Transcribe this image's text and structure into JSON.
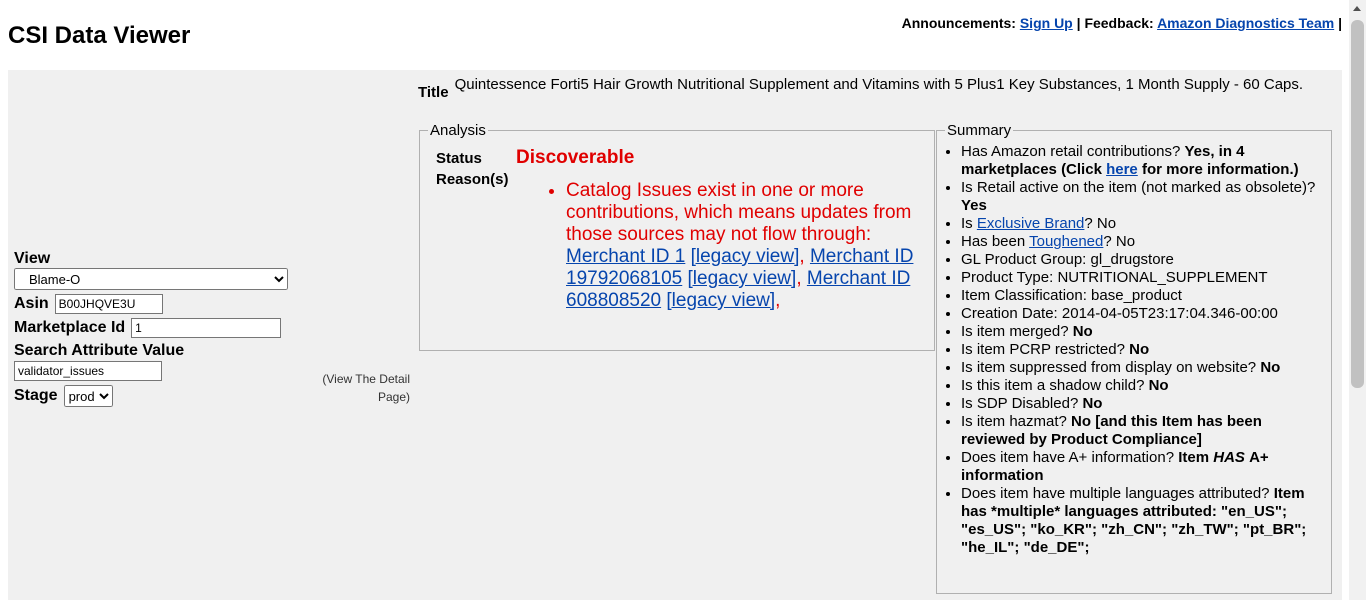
{
  "app_title": "CSI Data Viewer",
  "topbar": {
    "announcements_label": "Announcements:",
    "signup_link": "Sign Up",
    "sep1": "|",
    "feedback_label": "Feedback:",
    "feedback_link": "Amazon Diagnostics Team",
    "sep2": "|"
  },
  "form": {
    "view_label": "View",
    "view_value": "Blame-O",
    "asin_label": "Asin",
    "asin_value": "B00JHQVE3U",
    "marketplace_label": "Marketplace Id",
    "marketplace_value": "1",
    "search_attr_label": "Search Attribute Value",
    "search_attr_value": "validator_issues",
    "stage_label": "Stage",
    "stage_value": "prod"
  },
  "detail_page_link": "(View The Detail Page)",
  "item": {
    "title_label": "Title",
    "title_value": "Quintessence Forti5 Hair Growth Nutritional Supplement and Vitamins with 5 Plus1 Key Substances, 1 Month Supply - 60 Caps."
  },
  "analysis": {
    "legend": "Analysis",
    "status_label": "Status",
    "status_value": "Discoverable",
    "reasons_label": "Reason(s)",
    "reason_text": "Catalog Issues exist in one or more contributions, which means updates from those sources may not flow through:",
    "links": [
      {
        "merchant": "Merchant ID 1",
        "legacy": "[legacy view]"
      },
      {
        "merchant": "Merchant ID 19792068105",
        "legacy": "[legacy view]"
      },
      {
        "merchant": "Merchant ID 608808520",
        "legacy": "[legacy view]"
      }
    ],
    "comma": ","
  },
  "summary": {
    "legend": "Summary",
    "retail_q": "Has Amazon retail contributions?",
    "retail_a1": "Yes, in 4 marketplaces (Click",
    "retail_link": "here",
    "retail_a2": "for more information.)",
    "active_q": "Is Retail active on the item (not marked as obsolete)?",
    "active_a": "Yes",
    "exclusive_pre": "Is",
    "exclusive_link": "Exclusive Brand",
    "exclusive_post": "? No",
    "toughened_pre": "Has been",
    "toughened_link": "Toughened",
    "toughened_post": "? No",
    "gl": "GL Product Group: gl_drugstore",
    "ptype": "Product Type: NUTRITIONAL_SUPPLEMENT",
    "classif": "Item Classification: base_product",
    "creation": "Creation Date: 2014-04-05T23:17:04.346-00:00",
    "merged_q": "Is item merged?",
    "merged_a": "No",
    "pcrp_q": "Is item PCRP restricted?",
    "pcrp_a": "No",
    "suppressed_q": "Is item suppressed from display on website?",
    "suppressed_a": "No",
    "shadow_q": "Is this item a shadow child?",
    "shadow_a": "No",
    "sdp_q": "Is SDP Disabled?",
    "sdp_a": "No",
    "hazmat_q": "Is item hazmat?",
    "hazmat_a": "No [and this Item has been reviewed by Product Compliance]",
    "aplus_q": "Does item have A+ information?",
    "aplus_a1": "Item",
    "aplus_has": "HAS",
    "aplus_a2": "A+ information",
    "lang_q": "Does item have multiple languages attributed?",
    "lang_a": "Item has *multiple* languages attributed: \"en_US\"; \"es_US\"; \"ko_KR\"; \"zh_CN\"; \"zh_TW\"; \"pt_BR\"; \"he_IL\"; \"de_DE\";"
  }
}
